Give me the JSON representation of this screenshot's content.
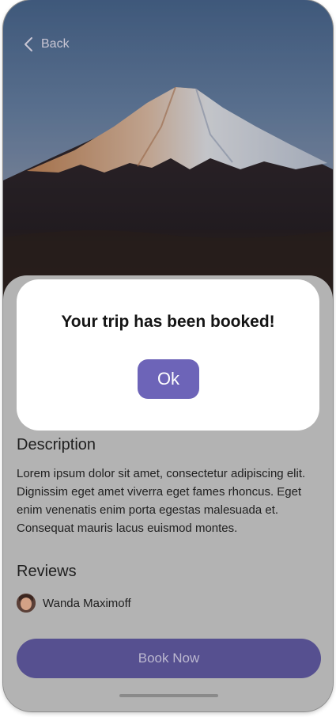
{
  "header": {
    "back_label": "Back"
  },
  "dialog": {
    "title": "Your trip has been booked!",
    "ok_label": "Ok"
  },
  "description": {
    "title": "Description",
    "body": "Lorem ipsum dolor sit amet, consectetur adipiscing elit. Dignissim eget amet viverra eget fames rhoncus. Eget enim venenatis enim porta egestas malesuada et. Consequat mauris lacus euismod montes."
  },
  "reviews": {
    "title": "Reviews",
    "items": [
      {
        "name": "Wanda Maximoff"
      }
    ]
  },
  "cta": {
    "book_label": "Book Now"
  },
  "colors": {
    "accent": "#6d64b8",
    "accent_dimmed": "#565090",
    "sheet_bg": "#b3b3b3"
  },
  "icons": {
    "back": "chevron-left-icon"
  }
}
